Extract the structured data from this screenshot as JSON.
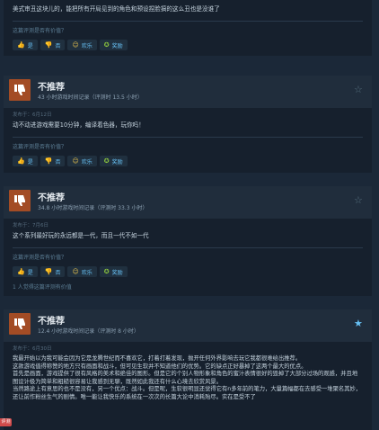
{
  "vote_labels": {
    "yes": "是",
    "no": "否",
    "funny": "欢乐",
    "award": "奖励"
  },
  "helpful_question": "这篇评测是否有价值？",
  "reviews": [
    {
      "text": "美式审丑这块儿的，能把所有开局见到的角色和预设捏脸搞的这么丑也是没谁了",
      "partial": true
    },
    {
      "title": "不推荐",
      "hours": "43 小时游戏时间记录（评测时 13.5 小时）",
      "posted": "发布于：6月12日",
      "text": "动不动进游戏需要10分钟，编译着色器，玩你吗！",
      "starred": false
    },
    {
      "title": "不推荐",
      "hours": "34.8 小时游戏时间记录（评测时 33.3 小时）",
      "posted": "发布于：7月6日",
      "text": "这个系列最好玩的永远都是一代，而且一代不如一代",
      "found_helpful": "1 人觉得这篇评测有价值",
      "starred": false
    },
    {
      "title": "不推荐",
      "hours": "12.4 小时游戏时间记录（评测时 8 小时）",
      "posted": "发布于：6月30日",
      "text": "我最开始以为我可能会因为它是龙腾世纪而不喜欢它，打着打着发现，抛开任何外界影响去玩它我都很难给出推荐。\n这款游戏值得称赞的地方只有画面和战斗，但可见生软并不知道他们的优势。它的缺点正好暴掉了这两个最大的优点。\n首先是画面，游戏提供了很有风格的美术和绝佳的图形。但是它的个别人物形象和角色的蜜汁表情很好的毁掉了大部分过场的观感，并且地图设计极为简单和粗糙很容易让我感到无聊，既然如此我还有什么心境去欣赏风景。\n当然路途上有意思的也不是没有，另一个优点：战斗。但是呢，生软很明显还觉得它有n多年前的笔力，大量篇幅都在去感受一堆聚名其妙，还让前作粉丝生气的剧情。唯一能让我快乐的系统在一次次的长篇大论中消耗殆尽。实在是受不了",
      "starred": true
    }
  ],
  "side_badge": "评测"
}
